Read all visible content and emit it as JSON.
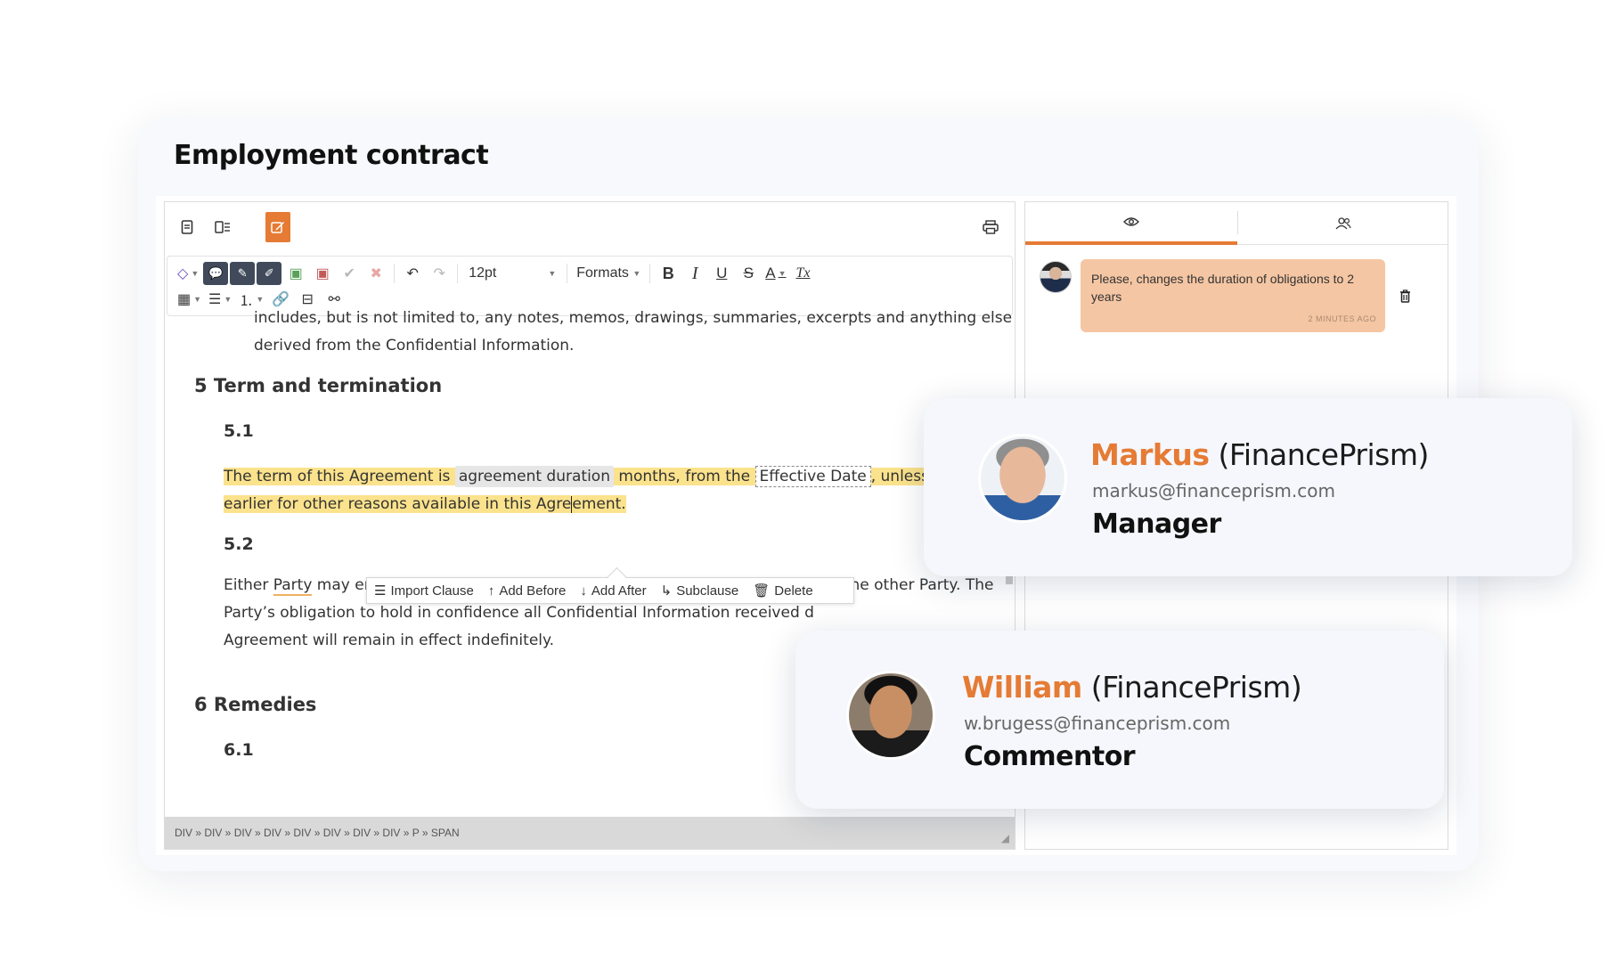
{
  "document": {
    "title": "Employment contract"
  },
  "topbar": {
    "icons": [
      "document-icon",
      "list-icon",
      "edit-icon",
      "print-icon"
    ]
  },
  "toolbar": {
    "font_size": "12pt",
    "formats_label": "Formats",
    "bold": "B",
    "italic": "I",
    "underline": "U",
    "strike": "S",
    "font_color": "A",
    "clear_format": "Tx"
  },
  "content": {
    "intro_line1": "includes, but is not limited to, any notes, memos, drawings, summaries, excerpts and anything else",
    "intro_line2": "derived from the Confidential Information.",
    "section5_title": "5 Term and termination",
    "s51": "5.1",
    "s51_a": "The term of this Agreement is ",
    "s51_field": "agreement duration",
    "s51_b": " months, from the ",
    "s51_effective": "Effective Date",
    "s51_c": ", unless ter",
    "s51_line2_a": "earlier for other reasons available in this Agre",
    "s51_line2_b": "ement.",
    "s52": "5.2",
    "s52_a": "Either ",
    "s52_party": "Party",
    "s52_b": " may end this Agreement at any time by providing a written notice to the other Party. The",
    "s52_line2": "Party’s obligation to hold in confidence all Confidential Information received d",
    "s52_line3": "Agreement will remain in effect indefinitely.",
    "section6_title": "6 Remedies",
    "s61": "6.1"
  },
  "clause_toolbar": {
    "import": "Import Clause",
    "add_before": "Add Before",
    "add_after": "Add After",
    "subclause": "Subclause",
    "delete": "Delete"
  },
  "statusbar": {
    "path": "DIV » DIV » DIV » DIV » DIV » DIV » DIV » DIV » P » SPAN"
  },
  "panel": {
    "tabs": [
      "eye-icon",
      "users-icon"
    ],
    "comment": {
      "text": "Please, changes the duration of obligations to 2 years",
      "time": "2 MINUTES AGO"
    }
  },
  "users": [
    {
      "first": "Markus",
      "org": " (FinancePrism)",
      "email": "markus@financeprism.com",
      "role": "Manager"
    },
    {
      "first": "William",
      "org": " (FinancePrism)",
      "email": "w.brugess@financeprism.com",
      "role": "Commentor"
    }
  ],
  "colors": {
    "accent": "#e57b34",
    "highlight": "#fbe28c",
    "comment_bubble": "#f5c6a3"
  }
}
